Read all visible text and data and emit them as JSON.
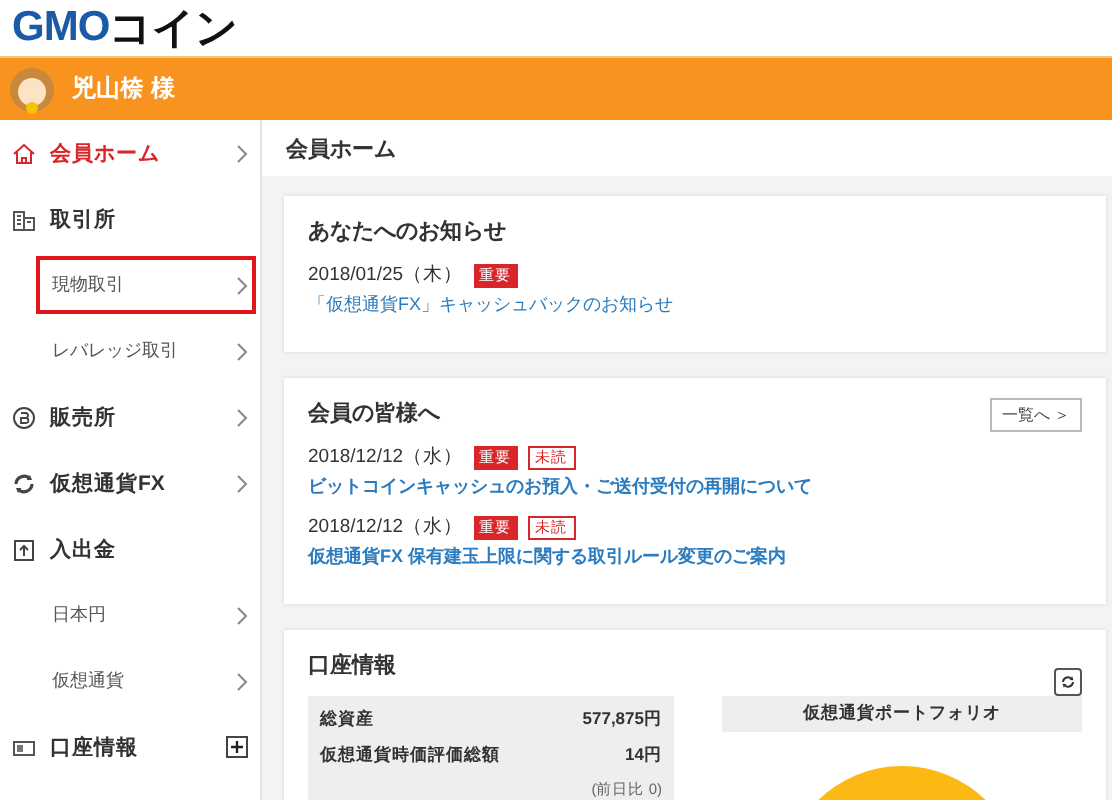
{
  "header": {
    "logo_latin": "GMO",
    "logo_kana": "コイン"
  },
  "user_bar": {
    "name": "兇山㮈 様"
  },
  "sidebar": {
    "items": [
      {
        "label": "会員ホーム",
        "kind": "link",
        "selected": true,
        "outlined": false
      },
      {
        "label": "取引所",
        "kind": "group",
        "selected": false,
        "outlined": false
      },
      {
        "label": "現物取引",
        "kind": "sub",
        "selected": false,
        "outlined": true
      },
      {
        "label": "レバレッジ取引",
        "kind": "sub",
        "selected": false,
        "outlined": false
      },
      {
        "label": "販売所",
        "kind": "link",
        "selected": false,
        "outlined": false
      },
      {
        "label": "仮想通貨FX",
        "kind": "link",
        "selected": false,
        "outlined": false
      },
      {
        "label": "入出金",
        "kind": "group",
        "selected": false,
        "outlined": false
      },
      {
        "label": "日本円",
        "kind": "sub",
        "selected": false,
        "outlined": false
      },
      {
        "label": "仮想通貨",
        "kind": "sub",
        "selected": false,
        "outlined": false
      },
      {
        "label": "口座情報",
        "kind": "expandable",
        "selected": false,
        "outlined": false
      }
    ]
  },
  "page_title": "会員ホーム",
  "notice_personal": {
    "title": "あなたへのお知らせ",
    "items": [
      {
        "date": "2018/01/25（木）",
        "important": "重要",
        "link": "「仮想通貨FX」キャッシュバックのお知らせ"
      }
    ]
  },
  "notice_members": {
    "title": "会員の皆様へ",
    "more_button": "一覧へ ＞",
    "items": [
      {
        "date": "2018/12/12（水）",
        "important": "重要",
        "unread": "未読",
        "link": "ビットコインキャッシュのお預入・ご送付受付の再開について"
      },
      {
        "date": "2018/12/12（水）",
        "important": "重要",
        "unread": "未読",
        "link": "仮想通貨FX 保有建玉上限に関する取引ルール変更のご案内"
      }
    ]
  },
  "account": {
    "title": "口座情報",
    "rows": [
      {
        "label": "総資産",
        "value": "577,875円"
      },
      {
        "label": "仮想通貨時価評価総額",
        "value": "14円"
      }
    ],
    "change": "(前日比 0)",
    "portfolio_title": "仮想通貨ポートフォリオ"
  }
}
